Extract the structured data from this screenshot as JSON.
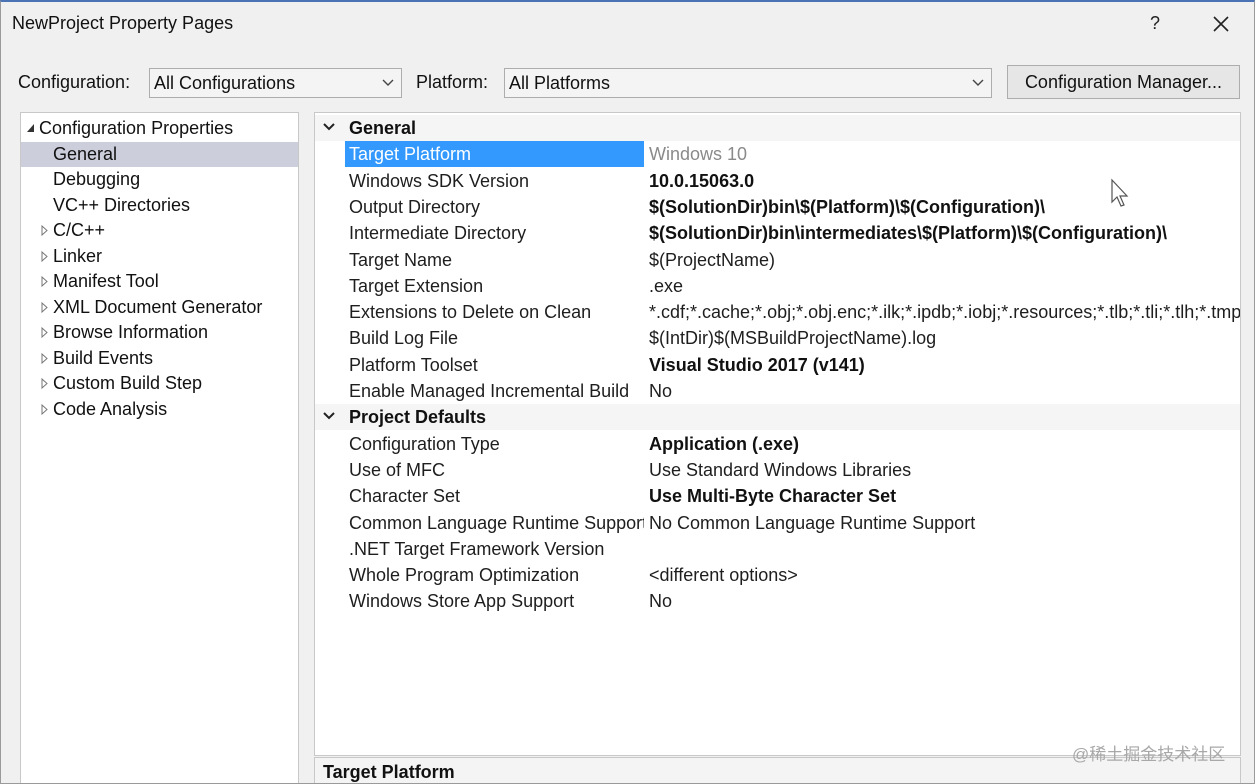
{
  "window": {
    "title": "NewProject Property Pages",
    "help": "?"
  },
  "toolbar": {
    "configuration_label": "Configuration:",
    "configuration_value": "All Configurations",
    "platform_label": "Platform:",
    "platform_value": "All Platforms",
    "config_manager_label": "Configuration Manager..."
  },
  "tree": [
    {
      "label": "Configuration Properties",
      "level": 0,
      "state": "expanded"
    },
    {
      "label": "General",
      "level": 1,
      "state": "none",
      "selected": true
    },
    {
      "label": "Debugging",
      "level": 1,
      "state": "none"
    },
    {
      "label": "VC++ Directories",
      "level": 1,
      "state": "none"
    },
    {
      "label": "C/C++",
      "level": 1,
      "state": "collapsed"
    },
    {
      "label": "Linker",
      "level": 1,
      "state": "collapsed"
    },
    {
      "label": "Manifest Tool",
      "level": 1,
      "state": "collapsed"
    },
    {
      "label": "XML Document Generator",
      "level": 1,
      "state": "collapsed"
    },
    {
      "label": "Browse Information",
      "level": 1,
      "state": "collapsed"
    },
    {
      "label": "Build Events",
      "level": 1,
      "state": "collapsed"
    },
    {
      "label": "Custom Build Step",
      "level": 1,
      "state": "collapsed"
    },
    {
      "label": "Code Analysis",
      "level": 1,
      "state": "collapsed"
    }
  ],
  "grid": {
    "categories": [
      {
        "name": "General",
        "rows": [
          {
            "name": "Target Platform",
            "value": "Windows 10",
            "style": "gray",
            "selected": true
          },
          {
            "name": "Windows SDK Version",
            "value": "10.0.15063.0",
            "style": "bold"
          },
          {
            "name": "Output Directory",
            "value": "$(SolutionDir)bin\\$(Platform)\\$(Configuration)\\",
            "style": "bold"
          },
          {
            "name": "Intermediate Directory",
            "value": "$(SolutionDir)bin\\intermediates\\$(Platform)\\$(Configuration)\\",
            "style": "bold"
          },
          {
            "name": "Target Name",
            "value": "$(ProjectName)",
            "style": "normal"
          },
          {
            "name": "Target Extension",
            "value": ".exe",
            "style": "normal"
          },
          {
            "name": "Extensions to Delete on Clean",
            "value": "*.cdf;*.cache;*.obj;*.obj.enc;*.ilk;*.ipdb;*.iobj;*.resources;*.tlb;*.tli;*.tlh;*.tmp;*.",
            "style": "normal"
          },
          {
            "name": "Build Log File",
            "value": "$(IntDir)$(MSBuildProjectName).log",
            "style": "normal"
          },
          {
            "name": "Platform Toolset",
            "value": "Visual Studio 2017 (v141)",
            "style": "bold"
          },
          {
            "name": "Enable Managed Incremental Build",
            "value": "No",
            "style": "normal"
          }
        ]
      },
      {
        "name": "Project Defaults",
        "rows": [
          {
            "name": "Configuration Type",
            "value": "Application (.exe)",
            "style": "bold"
          },
          {
            "name": "Use of MFC",
            "value": "Use Standard Windows Libraries",
            "style": "normal"
          },
          {
            "name": "Character Set",
            "value": "Use Multi-Byte Character Set",
            "style": "bold"
          },
          {
            "name": "Common Language Runtime Support",
            "value": "No Common Language Runtime Support",
            "style": "normal"
          },
          {
            "name": ".NET Target Framework Version",
            "value": "",
            "style": "normal"
          },
          {
            "name": "Whole Program Optimization",
            "value": "<different options>",
            "style": "normal"
          },
          {
            "name": "Windows Store App Support",
            "value": "No",
            "style": "normal"
          }
        ]
      }
    ]
  },
  "description": {
    "title": "Target Platform"
  },
  "watermark": "@稀土掘金技术社区"
}
